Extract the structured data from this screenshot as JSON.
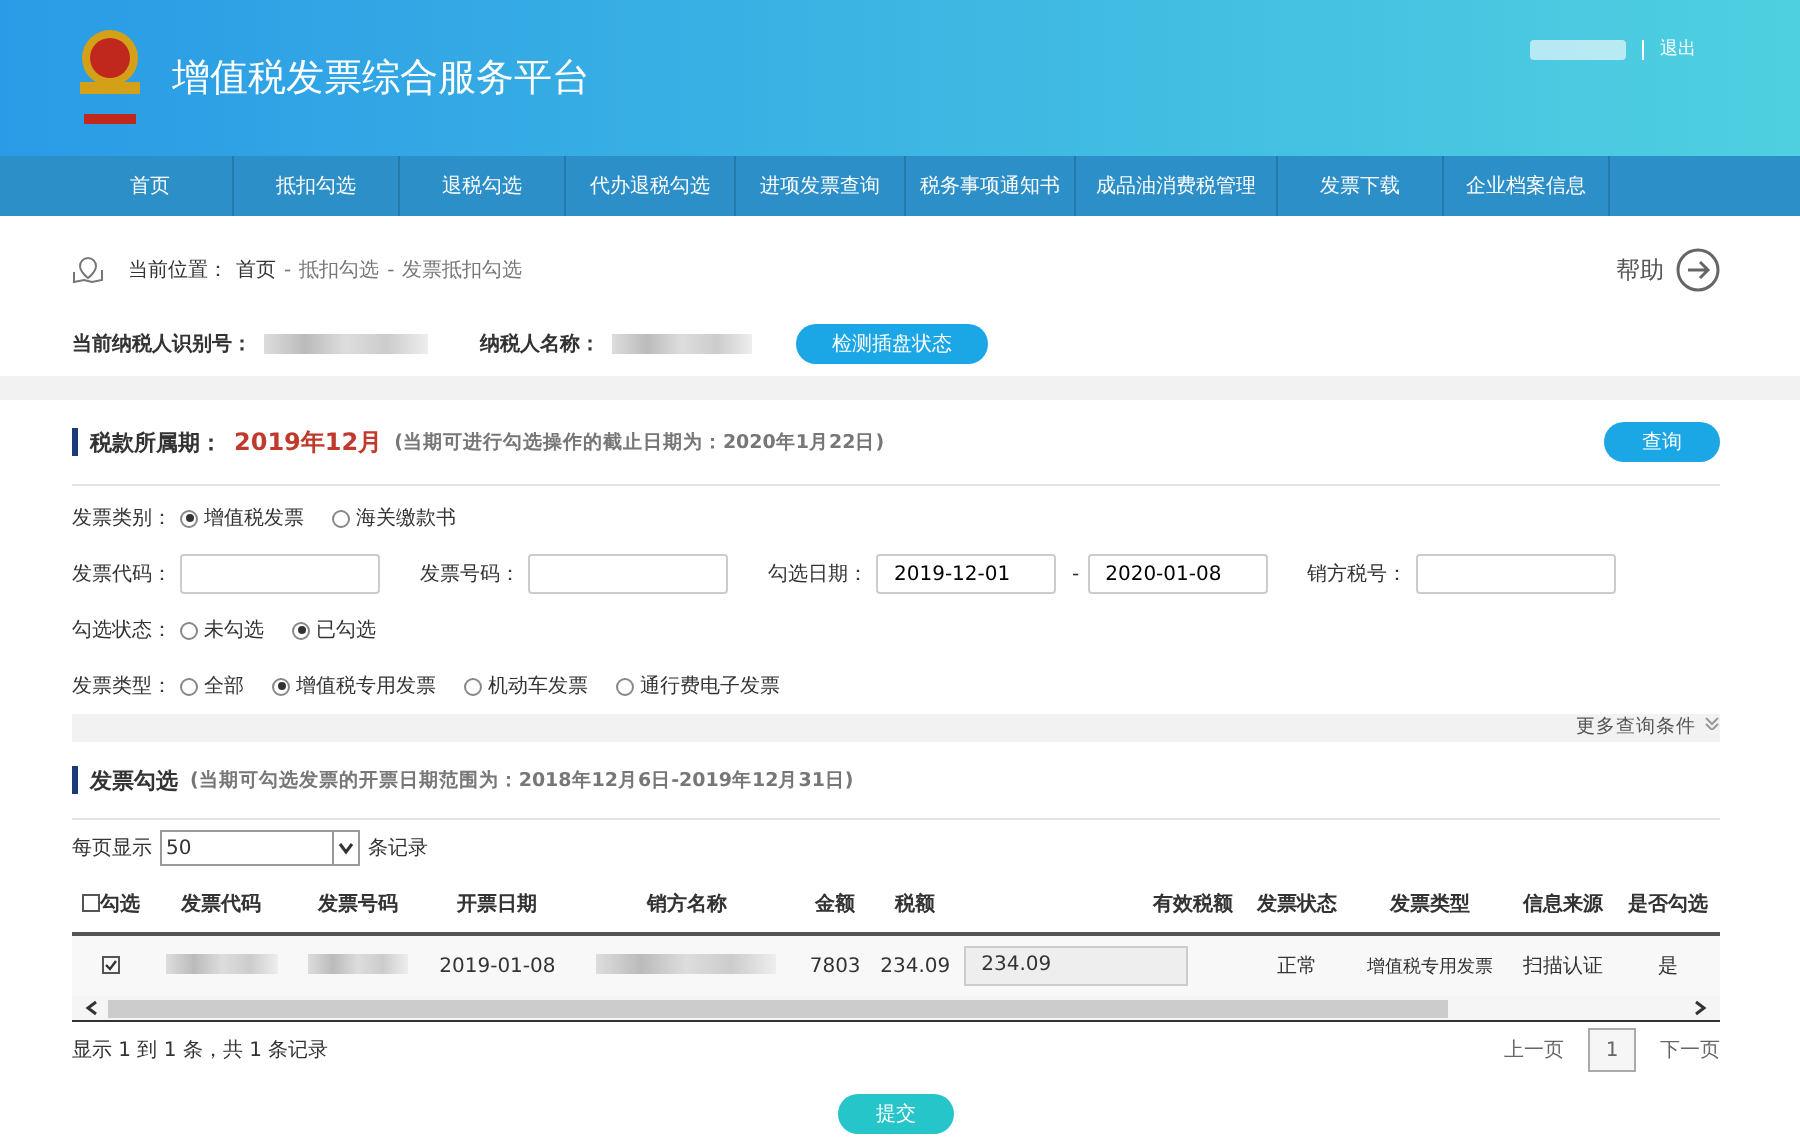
{
  "header": {
    "title": "增值税发票综合服务平台",
    "logout": "退出"
  },
  "nav": [
    "首页",
    "抵扣勾选",
    "退税勾选",
    "代办退税勾选",
    "进项发票查询",
    "税务事项通知书",
    "成品油消费税管理",
    "发票下载",
    "企业档案信息"
  ],
  "breadcrumb": {
    "label": "当前位置：",
    "items": [
      "首页",
      "抵扣勾选",
      "发票抵扣勾选"
    ],
    "separator": "-",
    "help": "帮助"
  },
  "taxpayer": {
    "id_label": "当前纳税人识别号：",
    "name_label": "纳税人名称：",
    "check_button": "检测插盘状态"
  },
  "period": {
    "label": "税款所属期：",
    "value": "2019年12月",
    "note": "(当期可进行勾选操作的截止日期为：2020年1月22日)",
    "query_button": "查询"
  },
  "filters": {
    "category": {
      "label": "发票类别：",
      "options": [
        {
          "label": "增值税发票",
          "selected": true
        },
        {
          "label": "海关缴款书",
          "selected": false
        }
      ]
    },
    "fields": [
      {
        "label": "发票代码："
      },
      {
        "label": "发票号码："
      },
      {
        "label": "勾选日期：",
        "value": "2019-12-01",
        "range_sep": "-",
        "value2": "2020-01-08"
      },
      {
        "label": "销方税号："
      }
    ],
    "status": {
      "label": "勾选状态：",
      "options": [
        {
          "label": "未勾选",
          "selected": false
        },
        {
          "label": "已勾选",
          "selected": true
        }
      ]
    },
    "type": {
      "label": "发票类型：",
      "options": [
        {
          "label": "全部",
          "selected": false
        },
        {
          "label": "增值税专用发票",
          "selected": true
        },
        {
          "label": "机动车发票",
          "selected": false
        },
        {
          "label": "通行费电子发票",
          "selected": false
        }
      ]
    },
    "more": "更多查询条件"
  },
  "invoices": {
    "title": "发票勾选",
    "note": "(当期可勾选发票的开票日期范围为：2018年12月6日-2019年12月31日)",
    "page_size_label": "每页显示",
    "page_size": "50",
    "page_size_suffix": "条记录",
    "header_checked": false,
    "columns": [
      "勾选",
      "发票代码",
      "发票号码",
      "开票日期",
      "销方名称",
      "金额",
      "税额",
      "有效税额",
      "发票状态",
      "发票类型",
      "信息来源",
      "是否勾选"
    ],
    "rows": [
      {
        "checked": true,
        "date": "2019-01-08",
        "amount": "7803",
        "tax": "234.09",
        "valid_tax": "234.09",
        "status": "正常",
        "type": "增值税专用发票",
        "source": "扫描认证",
        "chosen": "是"
      }
    ],
    "summary": "显示 1 到 1 条，共 1 条记录",
    "pager": {
      "prev": "上一页",
      "page": "1",
      "next": "下一页"
    },
    "submit": "提交"
  }
}
